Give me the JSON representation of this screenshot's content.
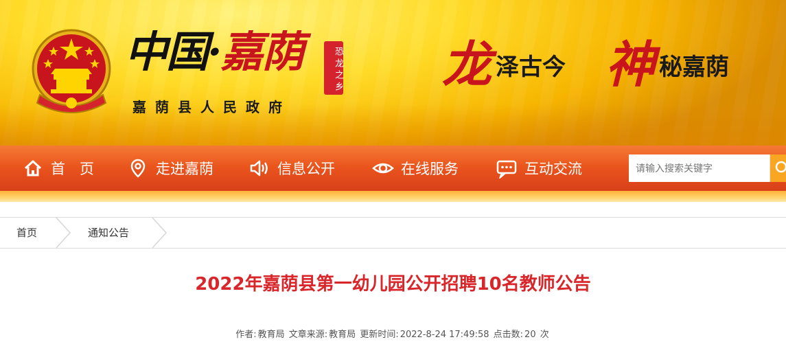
{
  "header": {
    "logo_text_part1": "中国",
    "logo_dot": "·",
    "logo_text_part2": "嘉荫",
    "seal_text": "恐龙之乡",
    "subname": "嘉荫县人民政府",
    "slogan1_char": "龙",
    "slogan1_text": "泽古今",
    "slogan2_char": "神",
    "slogan2_text": "秘嘉荫"
  },
  "nav": {
    "items": [
      {
        "label": "首　页",
        "icon": "home-icon"
      },
      {
        "label": "走进嘉荫",
        "icon": "location-pin-icon"
      },
      {
        "label": "信息公开",
        "icon": "speaker-icon"
      },
      {
        "label": "在线服务",
        "icon": "eye-icon"
      },
      {
        "label": "互动交流",
        "icon": "chat-icon"
      }
    ],
    "search_placeholder": "请输入搜索关键字"
  },
  "breadcrumb": {
    "items": [
      "首页",
      "通知公告"
    ]
  },
  "article": {
    "title": "2022年嘉荫县第一幼儿园公开招聘10名教师公告",
    "author_label": "作者:",
    "author": "教育局",
    "source_label": "文章来源:",
    "source": "教育局",
    "updated_label": "更新时间:",
    "updated": "2022-8-24 17:49:58",
    "clicks_label": "点击数:",
    "clicks": "20",
    "clicks_unit": "次"
  },
  "colors": {
    "nav_orange": "#e9531c",
    "title_red": "#d8262b",
    "brand_red": "#c8141d",
    "banner_yellow": "#ffdc2a"
  }
}
